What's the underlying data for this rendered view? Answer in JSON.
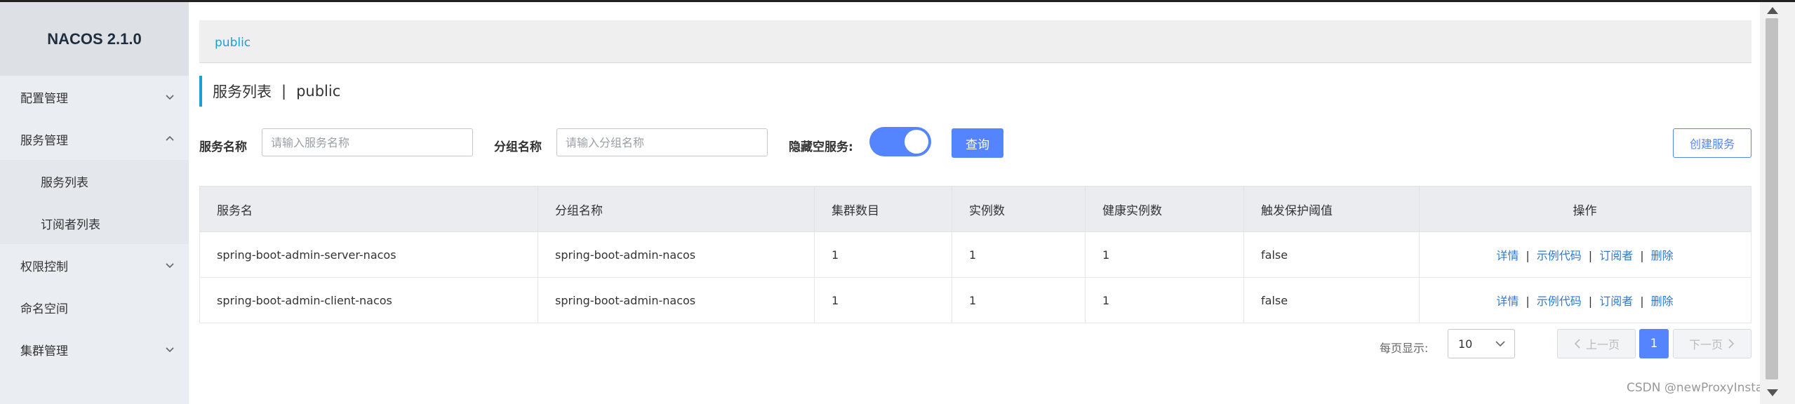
{
  "app": {
    "title": "NACOS 2.1.0"
  },
  "sidebar": {
    "items": [
      {
        "label": "配置管理",
        "icon": "chevron-down-icon"
      },
      {
        "label": "服务管理",
        "icon": "chevron-up-icon"
      },
      {
        "label": "服务列表"
      },
      {
        "label": "订阅者列表"
      },
      {
        "label": "权限控制",
        "icon": "chevron-down-icon"
      },
      {
        "label": "命名空间"
      },
      {
        "label": "集群管理",
        "icon": "chevron-down-icon"
      }
    ]
  },
  "breadcrumb": {
    "namespace": "public"
  },
  "page": {
    "title": "服务列表",
    "separator": "|",
    "namespace": "public"
  },
  "filters": {
    "service_name_label": "服务名称",
    "service_name_placeholder": "请输入服务名称",
    "group_name_label": "分组名称",
    "group_name_placeholder": "请输入分组名称",
    "hide_empty_label": "隐藏空服务:",
    "hide_empty_on": true,
    "query_button": "查询",
    "create_button": "创建服务"
  },
  "table": {
    "headers": [
      "服务名",
      "分组名称",
      "集群数目",
      "实例数",
      "健康实例数",
      "触发保护阈值",
      "操作"
    ],
    "rows": [
      [
        "spring-boot-admin-server-nacos",
        "spring-boot-admin-nacos",
        "1",
        "1",
        "1",
        "false"
      ],
      [
        "spring-boot-admin-client-nacos",
        "spring-boot-admin-nacos",
        "1",
        "1",
        "1",
        "false"
      ]
    ],
    "actions": [
      "详情",
      "示例代码",
      "订阅者",
      "删除"
    ],
    "action_sep": "|"
  },
  "pagination": {
    "per_page_label": "每页显示:",
    "per_page_value": "10",
    "prev": "上一页",
    "current_page": "1",
    "next": "下一页"
  },
  "watermark": "CSDN @newProxyInstance",
  "colors": {
    "accent": "#5584ff",
    "link": "#2d7ad6",
    "breadcrumb": "#1ba0d4",
    "sidebar_bg": "#eaedf1"
  }
}
